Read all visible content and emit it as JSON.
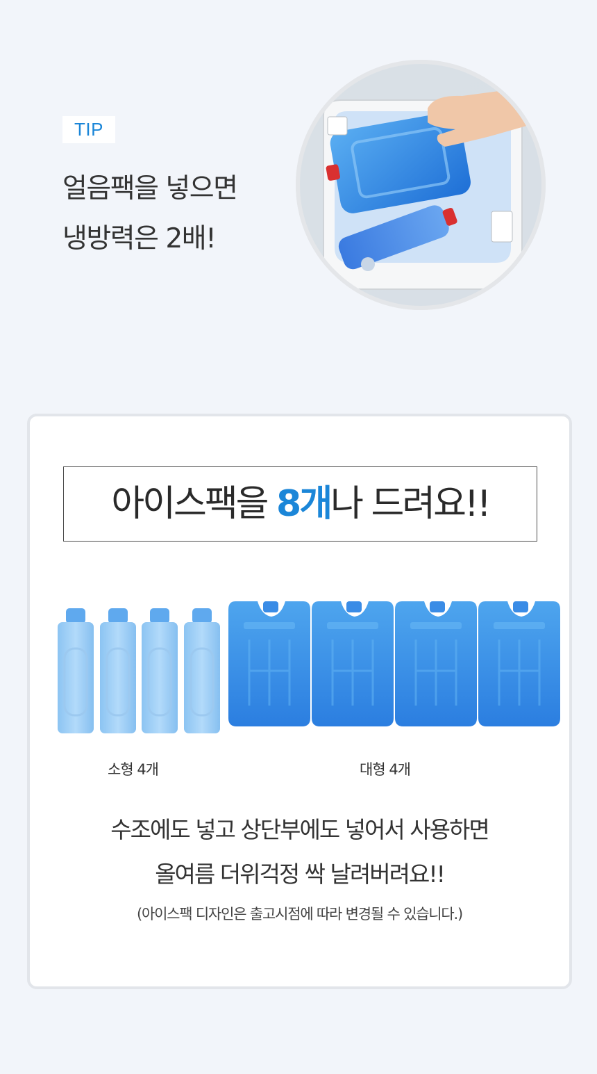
{
  "tip": {
    "badge": "TIP",
    "line1": "얼음팩을 넣으면",
    "line2": "냉방력은 2배!"
  },
  "card": {
    "headline_pre": "아이스팩을 ",
    "headline_highlight": "8개",
    "headline_post": "나 드려요!!",
    "small_label": "소형 4개",
    "large_label": "대형 4개",
    "body_line1": "수조에도 넣고 상단부에도 넣어서 사용하면",
    "body_line2": "올여름 더위걱정 싹 날려버려요!!",
    "note": "(아이스팩 디자인은 출고시점에 따라 변경될 수 있습니다.)"
  },
  "colors": {
    "accent": "#1b86d8",
    "background": "#f2f5fa",
    "card_border": "#e2e5ea"
  },
  "icons": [
    "small-ice-pack-icon",
    "large-ice-pack-icon"
  ]
}
